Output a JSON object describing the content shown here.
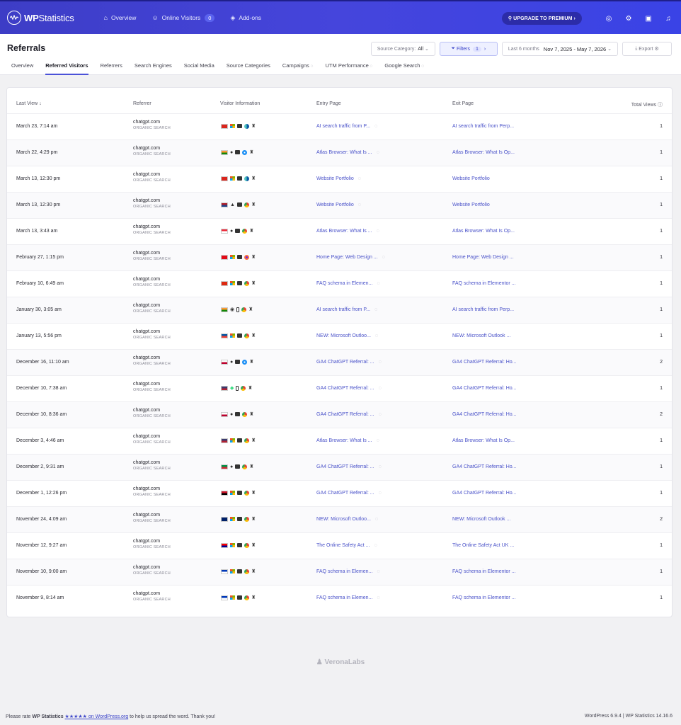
{
  "brand": {
    "logo_bold": "WP",
    "logo_rest": "Statistics"
  },
  "nav": {
    "overview": "Overview",
    "online_visitors": "Online Visitors",
    "online_count": "0",
    "addons": "Add-ons"
  },
  "top_right": {
    "upgrade": "UPGRADE TO PREMIUM"
  },
  "header": {
    "title": "Referrals",
    "source_category_label": "Source Category:",
    "source_category_value": "All",
    "filters_label": "Filters",
    "filters_count": "1",
    "date_preset": "Last 6 months",
    "date_range": "Nov 7, 2025 - May 7, 2026",
    "export": "Export"
  },
  "tabs": [
    "Overview",
    "Referred Visitors",
    "Referrers",
    "Search Engines",
    "Social Media",
    "Source Categories",
    "Campaigns",
    "UTM Performance",
    "Google Search"
  ],
  "table": {
    "headers": {
      "last_view": "Last View",
      "referrer": "Referrer",
      "visitor": "Visitor Information",
      "entry": "Entry Page",
      "exit": "Exit Page",
      "views": "Total Views"
    },
    "rows": [
      {
        "last": "March 23, 7:14 am",
        "ref": "chatgpt.com",
        "cat": "ORGANIC SEARCH",
        "entry": "AI search traffic from P...",
        "exit": "AI search traffic from Perp...",
        "views": "1"
      },
      {
        "last": "March 22, 4:29 pm",
        "ref": "chatgpt.com",
        "cat": "ORGANIC SEARCH",
        "entry": "Atlas Browser: What Is ...",
        "exit": "Atlas Browser: What Is Op...",
        "views": "1"
      },
      {
        "last": "March 13, 12:30 pm",
        "ref": "chatgpt.com",
        "cat": "ORGANIC SEARCH",
        "entry": "Website Portfolio",
        "exit": "Website Portfolio",
        "views": "1"
      },
      {
        "last": "March 13, 12:30 pm",
        "ref": "chatgpt.com",
        "cat": "ORGANIC SEARCH",
        "entry": "Website Portfolio",
        "exit": "Website Portfolio",
        "views": "1"
      },
      {
        "last": "March 13, 3:43 am",
        "ref": "chatgpt.com",
        "cat": "ORGANIC SEARCH",
        "entry": "Atlas Browser: What Is ...",
        "exit": "Atlas Browser: What Is Op...",
        "views": "1"
      },
      {
        "last": "February 27, 1:15 pm",
        "ref": "chatgpt.com",
        "cat": "ORGANIC SEARCH",
        "entry": "Home Page: Web Design ...",
        "exit": "Home Page: Web Design ...",
        "views": "1"
      },
      {
        "last": "February 10, 6:49 am",
        "ref": "chatgpt.com",
        "cat": "ORGANIC SEARCH",
        "entry": "FAQ schema in Elemen...",
        "exit": "FAQ schema in Elementor ...",
        "views": "1"
      },
      {
        "last": "January 30, 3:05 am",
        "ref": "chatgpt.com",
        "cat": "ORGANIC SEARCH",
        "entry": "AI search traffic from P...",
        "exit": "AI search traffic from Perp...",
        "views": "1"
      },
      {
        "last": "January 13, 5:56 pm",
        "ref": "chatgpt.com",
        "cat": "ORGANIC SEARCH",
        "entry": "NEW: Microsoft Outloo...",
        "exit": "NEW: Microsoft Outlook ...",
        "views": "1"
      },
      {
        "last": "December 16, 11:10 am",
        "ref": "chatgpt.com",
        "cat": "ORGANIC SEARCH",
        "entry": "GA4 ChatGPT Referral: ...",
        "exit": "GA4 ChatGPT Referral: Ho...",
        "views": "2"
      },
      {
        "last": "December 10, 7:38 am",
        "ref": "chatgpt.com",
        "cat": "ORGANIC SEARCH",
        "entry": "GA4 ChatGPT Referral: ...",
        "exit": "GA4 ChatGPT Referral: Ho...",
        "views": "1"
      },
      {
        "last": "December 10, 8:36 am",
        "ref": "chatgpt.com",
        "cat": "ORGANIC SEARCH",
        "entry": "GA4 ChatGPT Referral: ...",
        "exit": "GA4 ChatGPT Referral: Ho...",
        "views": "2"
      },
      {
        "last": "December 3, 4:46 am",
        "ref": "chatgpt.com",
        "cat": "ORGANIC SEARCH",
        "entry": "Atlas Browser: What Is ...",
        "exit": "Atlas Browser: What Is Op...",
        "views": "1"
      },
      {
        "last": "December 2, 9:31 am",
        "ref": "chatgpt.com",
        "cat": "ORGANIC SEARCH",
        "entry": "GA4 ChatGPT Referral: ...",
        "exit": "GA4 ChatGPT Referral: Ho...",
        "views": "1"
      },
      {
        "last": "December 1, 12:26 pm",
        "ref": "chatgpt.com",
        "cat": "ORGANIC SEARCH",
        "entry": "GA4 ChatGPT Referral: ...",
        "exit": "GA4 ChatGPT Referral: Ho...",
        "views": "1"
      },
      {
        "last": "November 24, 4:09 am",
        "ref": "chatgpt.com",
        "cat": "ORGANIC SEARCH",
        "entry": "NEW: Microsoft Outloo...",
        "exit": "NEW: Microsoft Outlook ...",
        "views": "2"
      },
      {
        "last": "November 12, 9:27 am",
        "ref": "chatgpt.com",
        "cat": "ORGANIC SEARCH",
        "entry": "The Online Safety Act ...",
        "exit": "The Online Safety Act UK ...",
        "views": "1"
      },
      {
        "last": "November 10, 9:00 am",
        "ref": "chatgpt.com",
        "cat": "ORGANIC SEARCH",
        "entry": "FAQ schema in Elemen...",
        "exit": "FAQ schema in Elementor ...",
        "views": "1"
      },
      {
        "last": "November 9, 8:14 am",
        "ref": "chatgpt.com",
        "cat": "ORGANIC SEARCH",
        "entry": "FAQ schema in Elemen...",
        "exit": "FAQ schema in Elementor ...",
        "views": "1"
      }
    ]
  },
  "footer": {
    "brand": "VeronaLabs",
    "rate_prefix": "Please rate",
    "rate_product": "WP Statistics",
    "rate_link": "★★★★★ on WordPress.org",
    "rate_suffix": "to help us spread the word. Thank you!",
    "version": "WordPress 6.9.4 | WP Statistics 14.16.6"
  }
}
